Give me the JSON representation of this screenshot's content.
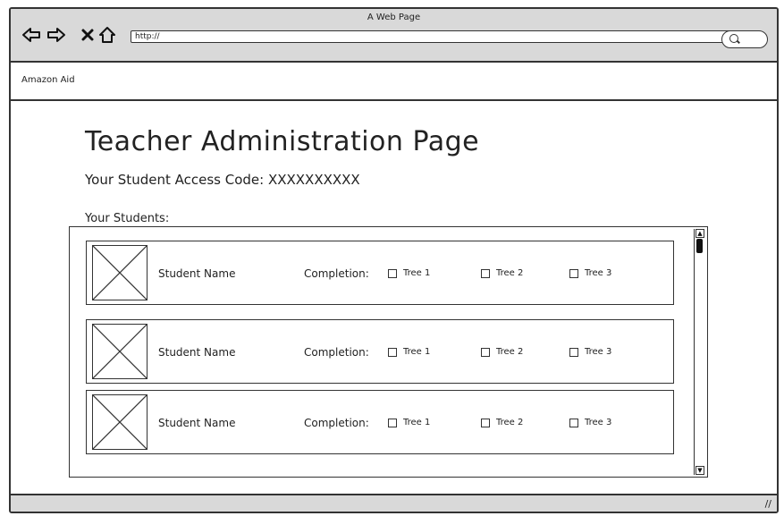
{
  "browser": {
    "window_title": "A Web Page",
    "address_value": "http://",
    "back_icon": "back-arrow-icon",
    "forward_icon": "forward-arrow-icon",
    "stop_icon": "close-icon",
    "home_icon": "home-icon",
    "search_icon": "search-icon"
  },
  "appbar": {
    "label": "Amazon Aid"
  },
  "page": {
    "title": "Teacher Administration Page",
    "access_code": "Your Student Access Code: XXXXXXXXXX",
    "students_label": "Your Students:"
  },
  "students": [
    {
      "name": "Student Name",
      "completion_label": "Completion:",
      "trees": [
        "Tree 1",
        "Tree 2",
        "Tree 3"
      ]
    },
    {
      "name": "Student Name",
      "completion_label": "Completion:",
      "trees": [
        "Tree 1",
        "Tree 2",
        "Tree 3"
      ]
    },
    {
      "name": "Student Name",
      "completion_label": "Completion:",
      "trees": [
        "Tree 1",
        "Tree 2",
        "Tree 3"
      ]
    }
  ],
  "colors": {
    "chrome": "#d9d9d9",
    "border": "#333333",
    "background": "#ffffff"
  }
}
